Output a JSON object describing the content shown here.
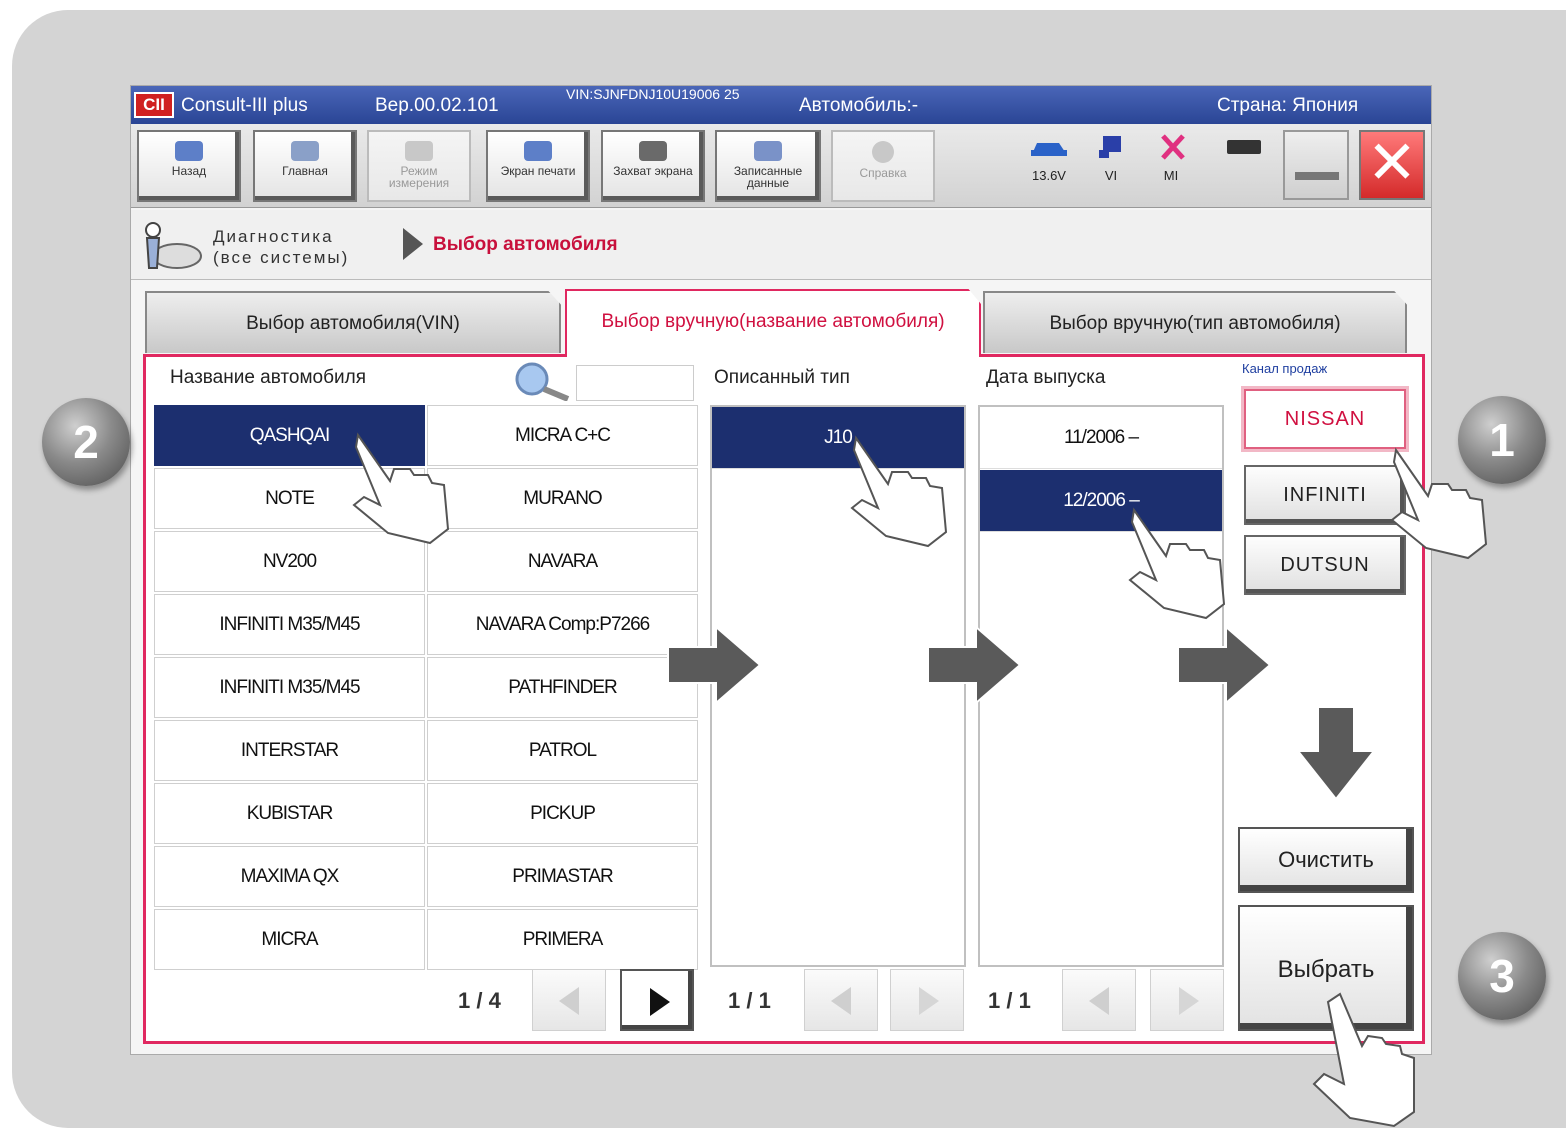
{
  "titlebar": {
    "logo": "CII",
    "app_name": "Consult-III plus",
    "version": "Вер.00.02.101",
    "vin": "VIN:SJNFDNJ10U19006 25",
    "vehicle": "Автомобиль:-",
    "country": "Страна: Япония"
  },
  "toolbar": {
    "back": "Назад",
    "home": "Главная",
    "measure_mode": "Режим измерения",
    "print_screen": "Экран печати",
    "capture_screen": "Захват экрана",
    "recorded_data": "Записанные данные",
    "help": "Справка",
    "voltage": "13.6V",
    "vi": "VI",
    "mi": "MI"
  },
  "breadcrumb": {
    "main": "Диагностика\n(все системы)",
    "current": "Выбор автомобиля"
  },
  "tabs": [
    {
      "label": "Выбор автомобиля(VIN)"
    },
    {
      "label": "Выбор вручную(название автомобиля)"
    },
    {
      "label": "Выбор вручную(тип автомобиля)"
    }
  ],
  "car_list": {
    "header": "Название автомобиля",
    "left": [
      "QASHQAI",
      "NOTE",
      "NV200",
      "INFINITI M35/M45",
      "INFINITI M35/M45",
      "INTERSTAR",
      "KUBISTAR",
      "MAXIMA QX",
      "MICRA"
    ],
    "right": [
      "MICRA C+C",
      "MURANO",
      "NAVARA",
      "NAVARA Comp:P7266",
      "PATHFINDER",
      "PATROL",
      "PICKUP",
      "PRIMASTAR",
      "PRIMERA"
    ],
    "selected": "QASHQAI",
    "page": "1 / 4"
  },
  "type_list": {
    "header": "Описанный тип",
    "items": [
      "J10"
    ],
    "selected": "J10",
    "page": "1 / 1"
  },
  "date_list": {
    "header": "Дата выпуска",
    "items": [
      "11/2006 –",
      "12/2006 –"
    ],
    "selected": "12/2006 –",
    "page": "1 / 1"
  },
  "sales_channel": {
    "title": "Канал продаж",
    "options": [
      "NISSAN",
      "INFINITI",
      "DUTSUN"
    ],
    "selected": "NISSAN"
  },
  "actions": {
    "clear": "Очистить",
    "select": "Выбрать"
  },
  "badges": [
    "1",
    "2",
    "3"
  ],
  "colors": {
    "accent": "#e02860",
    "selection": "#1c2f6f",
    "titlebar": "#2a4595"
  }
}
